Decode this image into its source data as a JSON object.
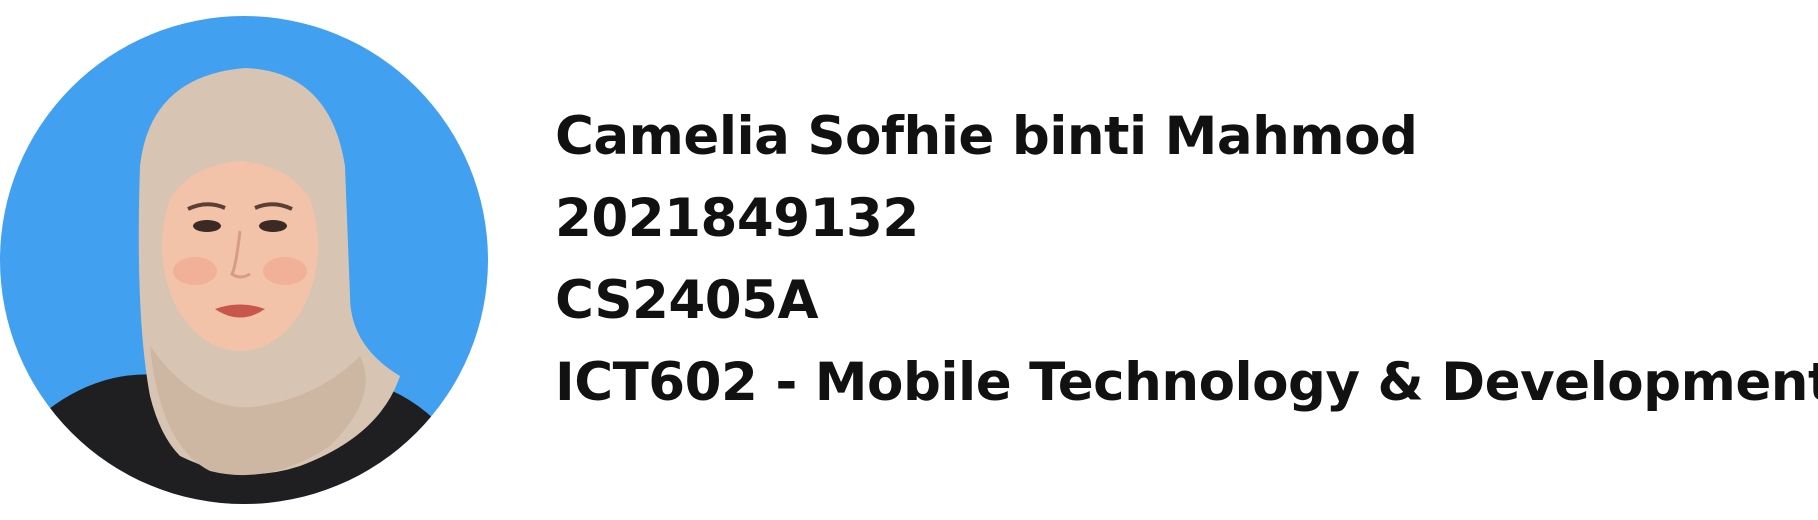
{
  "profile": {
    "name": "Camelia Sofhie binti Mahmod",
    "student_id": "2021849132",
    "group": "CS2405A",
    "course": "ICT602 - Mobile Technology & Development"
  },
  "colors": {
    "photo_background": "#42a0f0",
    "text": "#111111",
    "page_background": "#ffffff"
  }
}
